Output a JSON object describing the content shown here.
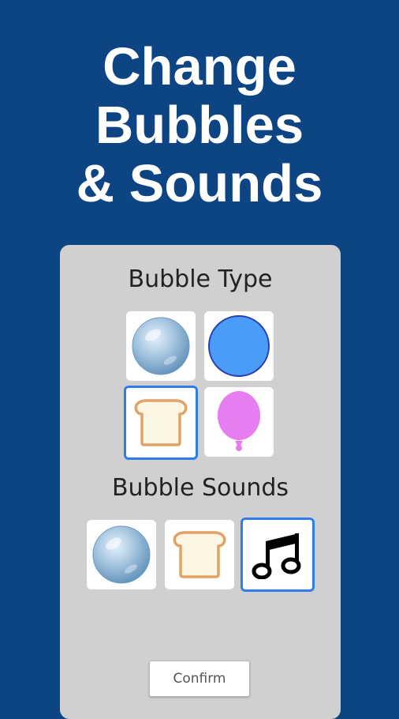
{
  "headline": {
    "lines": [
      "Change",
      "Bubbles",
      "& Sounds"
    ]
  },
  "bubble_type": {
    "title": "Bubble Type",
    "options": [
      {
        "name": "glass-bubble",
        "icon": "glass-bubble-icon",
        "selected": false
      },
      {
        "name": "blue-circle",
        "icon": "blue-circle-icon",
        "selected": false
      },
      {
        "name": "toast",
        "icon": "toast-icon",
        "selected": true
      },
      {
        "name": "balloon",
        "icon": "balloon-icon",
        "selected": false
      }
    ]
  },
  "bubble_sounds": {
    "title": "Bubble Sounds",
    "options": [
      {
        "name": "glass-bubble",
        "icon": "glass-bubble-icon",
        "selected": false
      },
      {
        "name": "toast",
        "icon": "toast-icon",
        "selected": false
      },
      {
        "name": "music",
        "icon": "music-note-icon",
        "selected": true
      }
    ]
  },
  "confirm_label": "Confirm",
  "colors": {
    "background": "#0d4483",
    "panel": "#d0d0d0",
    "selection": "#2f7de8",
    "circle_blue": "#4b9cf7",
    "balloon_pink": "#e67ef2",
    "toast_fill": "#fdf6e4",
    "toast_stroke": "#e2a266"
  }
}
